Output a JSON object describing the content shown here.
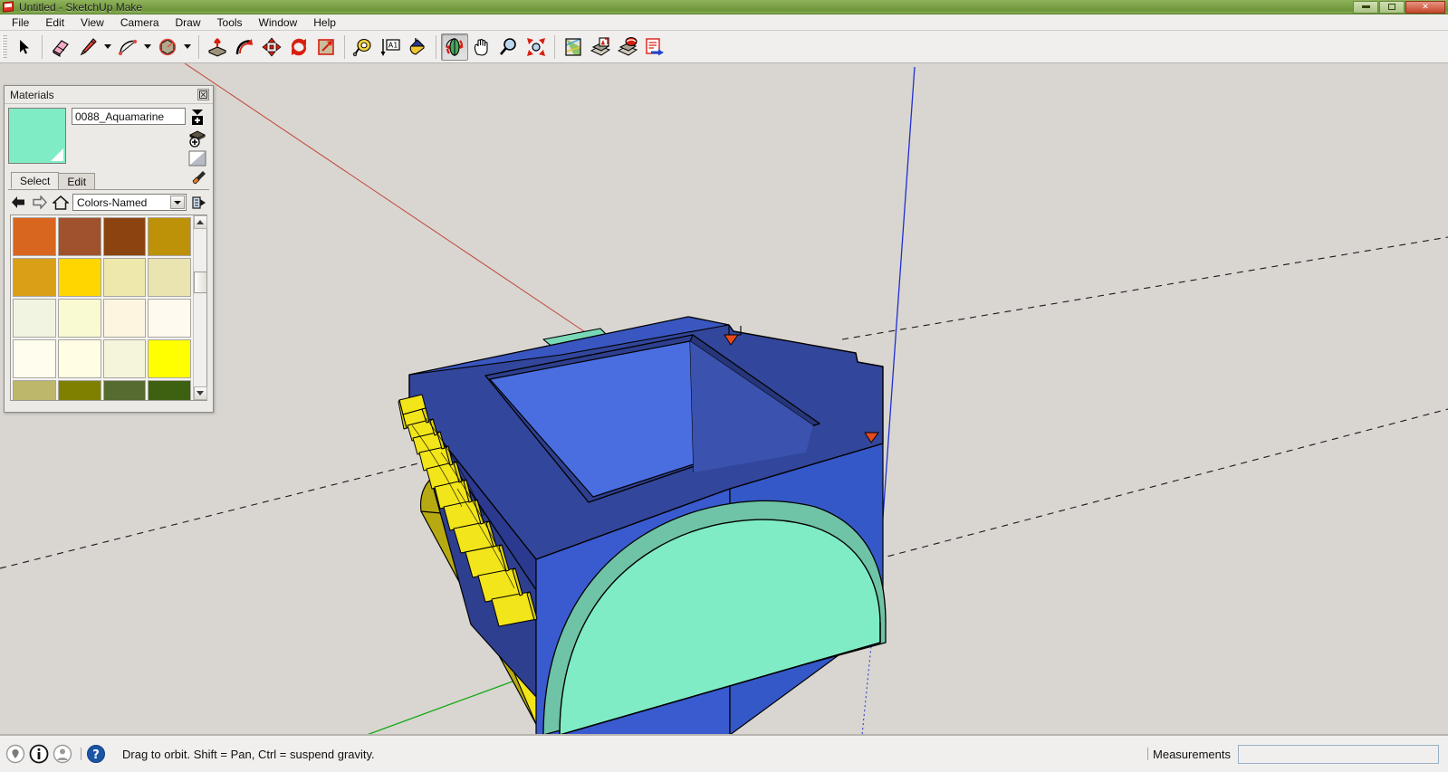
{
  "window": {
    "title": "Untitled - SketchUp Make",
    "app_icon": "sketchup-icon",
    "controls": [
      {
        "name": "minimize-button",
        "glyph": "minimize-icon"
      },
      {
        "name": "restore-button",
        "glyph": "restore-icon"
      },
      {
        "name": "close-button",
        "glyph": "close-icon",
        "label": "✕"
      }
    ]
  },
  "menu": {
    "items": [
      {
        "label": "File"
      },
      {
        "label": "Edit"
      },
      {
        "label": "View"
      },
      {
        "label": "Camera"
      },
      {
        "label": "Draw"
      },
      {
        "label": "Tools"
      },
      {
        "label": "Window"
      },
      {
        "label": "Help"
      }
    ]
  },
  "toolbar": {
    "groups": [
      {
        "tools": [
          {
            "name": "select-tool-button",
            "icon": "cursor-arrow-icon",
            "active": false,
            "dropdown": false
          }
        ]
      },
      {
        "tools": [
          {
            "name": "eraser-tool-button",
            "icon": "eraser-icon",
            "active": false,
            "dropdown": false
          },
          {
            "name": "line-tool-button",
            "icon": "pencil-icon",
            "active": false,
            "dropdown": true
          },
          {
            "name": "arc-tool-button",
            "icon": "arc-icon",
            "active": false,
            "dropdown": true
          },
          {
            "name": "shapes-tool-button",
            "icon": "polygon-icon",
            "active": false,
            "dropdown": true
          }
        ]
      },
      {
        "tools": [
          {
            "name": "push-pull-tool-button",
            "icon": "push-pull-icon",
            "active": false,
            "dropdown": false
          },
          {
            "name": "follow-me-tool-button",
            "icon": "follow-me-icon",
            "active": false,
            "dropdown": false
          },
          {
            "name": "move-tool-button",
            "icon": "move-arrows-icon",
            "active": false,
            "dropdown": false
          },
          {
            "name": "rotate-tool-button",
            "icon": "rotate-icon",
            "active": false,
            "dropdown": false
          },
          {
            "name": "scale-tool-button",
            "icon": "scale-icon",
            "active": false,
            "dropdown": false
          }
        ]
      },
      {
        "tools": [
          {
            "name": "tape-measure-tool-button",
            "icon": "tape-measure-icon",
            "active": false,
            "dropdown": false
          },
          {
            "name": "dimension-tool-button",
            "icon": "dimension-icon",
            "active": false,
            "dropdown": false
          },
          {
            "name": "paint-bucket-tool-button",
            "icon": "paint-bucket-icon",
            "active": false,
            "dropdown": false
          }
        ]
      },
      {
        "tools": [
          {
            "name": "orbit-tool-button",
            "icon": "orbit-icon",
            "active": true,
            "dropdown": false
          },
          {
            "name": "pan-tool-button",
            "icon": "hand-icon",
            "active": false,
            "dropdown": false
          },
          {
            "name": "zoom-tool-button",
            "icon": "magnifier-icon",
            "active": false,
            "dropdown": false
          },
          {
            "name": "zoom-extents-tool-button",
            "icon": "zoom-extents-icon",
            "active": false,
            "dropdown": false
          }
        ]
      },
      {
        "tools": [
          {
            "name": "add-location-button",
            "icon": "map-icon",
            "active": false,
            "dropdown": false
          },
          {
            "name": "photo-textures-button",
            "icon": "photo-texture-icon",
            "active": false,
            "dropdown": false
          },
          {
            "name": "get-models-button",
            "icon": "get-models-icon",
            "active": false,
            "dropdown": false
          },
          {
            "name": "share-model-button",
            "icon": "share-model-icon",
            "active": false,
            "dropdown": false
          }
        ]
      }
    ]
  },
  "materials_panel": {
    "title": "Materials",
    "close_label": "☒",
    "current_material": {
      "name": "0088_Aquamarine",
      "color": "#7fecc5"
    },
    "side_buttons": [
      {
        "name": "create-material-button",
        "icon": "create-material-icon"
      },
      {
        "name": "set-as-default-button",
        "icon": "add-to-model-icon"
      },
      {
        "name": "display-swatch-button",
        "icon": "swatch-preview-icon"
      }
    ],
    "tabs": [
      {
        "label": "Select",
        "selected": true
      },
      {
        "label": "Edit",
        "selected": false
      }
    ],
    "tab_right_icon": "eyedropper-icon",
    "nav": {
      "back_icon": "back-arrow-icon",
      "forward_icon": "forward-arrow-icon",
      "home_icon": "home-icon",
      "library": "Colors-Named",
      "details_icon": "details-icon"
    },
    "swatch_colors": [
      "#d9661f",
      "#a0522d",
      "#8b4410",
      "#bd9108",
      "#d9a017",
      "#ffd600",
      "#eee8aa",
      "#e9e4b0",
      "#f2f4e2",
      "#fafad2",
      "#fdf5e0",
      "#fffaf0",
      "#fffdee",
      "#fffde4",
      "#f5f5dc",
      "#ffff00",
      "#bdb76b",
      "#808000",
      "#556b2f",
      "#3d6111"
    ],
    "scrollbar": {
      "up_icon": "scroll-up-icon",
      "down_icon": "scroll-down-icon"
    }
  },
  "statusbar": {
    "icons": [
      {
        "name": "geo-location-icon"
      },
      {
        "name": "model-info-icon"
      },
      {
        "name": "user-account-icon"
      }
    ],
    "help_icon": "help-question-icon",
    "hint": "Drag to orbit. Shift = Pan, Ctrl = suspend gravity.",
    "measurements_label": "Measurements",
    "measurements_value": ""
  },
  "viewport": {
    "background": "#d9d6d1",
    "axes": {
      "red_axis": "#c0392b",
      "green_axis": "#14a814",
      "blue_axis": "#1e2fd0",
      "dashed": "#1a1a1a"
    },
    "model": {
      "description": "blue box with recessed square cavity, aquamarine dome, yellow stepped blocks",
      "colors": {
        "box_top": "#32469b",
        "box_top_light": "#3a56c0",
        "cavity_floor": "#4a6ee0",
        "cavity_side": "#2e3f8f",
        "box_front_left": "#3a5ad0",
        "box_front_right": "#3558c8",
        "dome": "#7fecc5",
        "dome_rim": "#6fc3a6",
        "yellow_bright": "#f2e51a",
        "yellow_dark": "#c2b412",
        "marker_orange": "#e8491c",
        "gray_part": "#8c8a7e",
        "outline": "#000000"
      }
    }
  }
}
